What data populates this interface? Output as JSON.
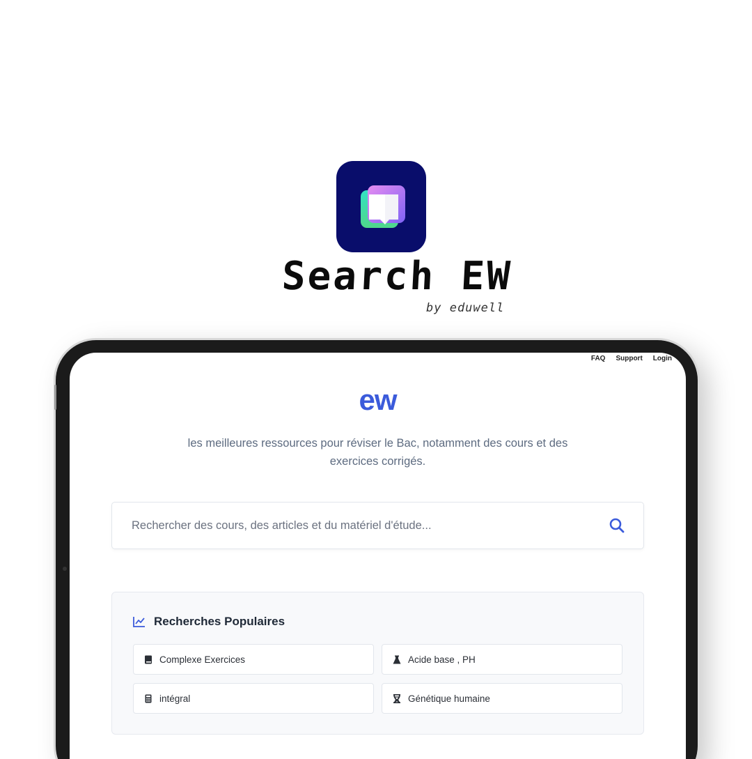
{
  "brand": {
    "title": "Search EW",
    "subtitle": "by eduwell",
    "icon": "book-icon",
    "icon_bg": "#090d6b"
  },
  "nav": {
    "links": [
      "FAQ",
      "Support",
      "Login"
    ]
  },
  "hero": {
    "logo": "ew",
    "accent_color": "#3b5bdb",
    "tagline": "les meilleures ressources pour réviser le Bac, notamment des cours et des exercices corrigés."
  },
  "search": {
    "placeholder": "Rechercher des cours, des articles et du matériel d'étude...",
    "value": "",
    "icon": "search-icon"
  },
  "popular": {
    "title": "Recherches Populaires",
    "icon": "trending-chart-icon",
    "items": [
      {
        "label": "Complexe Exercices",
        "icon": "book-icon"
      },
      {
        "label": "Acide base , PH",
        "icon": "flask-icon"
      },
      {
        "label": "intégral",
        "icon": "calculator-icon"
      },
      {
        "label": "Génétique humaine",
        "icon": "dna-icon"
      }
    ]
  }
}
